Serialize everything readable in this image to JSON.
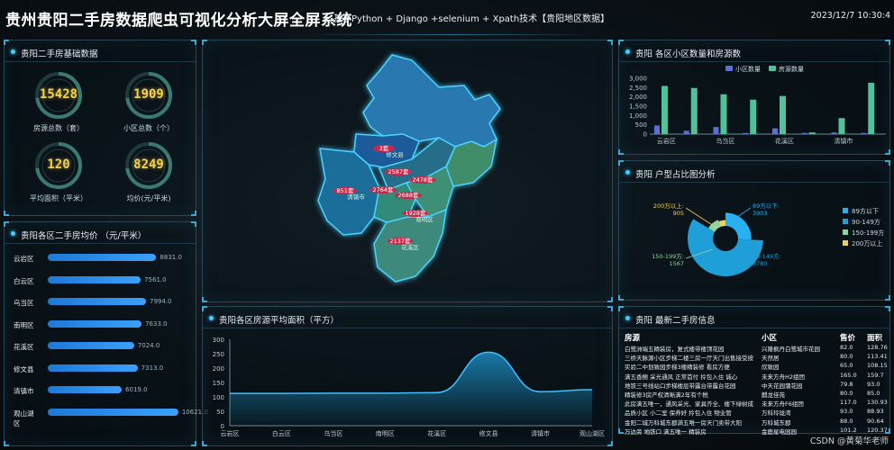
{
  "header": {
    "title": "贵州贵阳二手房数据爬虫可视化分析大屏全屏系统",
    "subtitle": "基于Python + Django +selenium + Xpath技术【贵阳地区数据】",
    "datetime": "2023/12/7 10:30:4"
  },
  "basic": {
    "title": "贵阳二手房基础数据",
    "items": [
      {
        "value": "15428",
        "label": "房源总数（套）"
      },
      {
        "value": "1909",
        "label": "小区总数（个）"
      },
      {
        "value": "120",
        "label": "平均面积（平米）"
      },
      {
        "value": "8249",
        "label": "均价(元/平米)"
      }
    ]
  },
  "price_panel": {
    "title": "贵阳各区二手房均价 （元/平米）"
  },
  "map_panel": {
    "regions": [
      {
        "count": "3套",
        "name": "修文县",
        "color": "#c8284a"
      },
      {
        "count": "2587套",
        "name": "",
        "color": "#c8284a"
      },
      {
        "count": "2478套",
        "name": "",
        "color": "#c8284a"
      },
      {
        "count": "851套",
        "name": "清镇市",
        "color": "#c8284a"
      },
      {
        "count": "2764套",
        "name": "",
        "color": "#c8284a"
      },
      {
        "count": "2688套",
        "name": "",
        "color": "#c8284a"
      },
      {
        "count": "1928套",
        "name": "南明区",
        "color": "#c8284a"
      },
      {
        "count": "2137套",
        "name": "花溪区",
        "color": "#c8284a"
      }
    ]
  },
  "area_panel": {
    "title": "贵阳各区房源平均面积（平方）"
  },
  "community_panel": {
    "title": "贵阳 各区小区数量和房源数"
  },
  "huxing_panel": {
    "title": "贵阳 户型占比图分析"
  },
  "listing_panel": {
    "title": "贵阳 最新二手房信息",
    "headers": [
      "房源",
      "小区",
      "售价",
      "面积"
    ],
    "rows": [
      [
        "白鹭洲端五精装房，复式楼带楼顶花园",
        "兴隆枫丹白鹭城市花园",
        "82.0",
        "128.76"
      ],
      [
        "三桥天脉源小区步梯二楼三房一厅天门出售接受按",
        "天然居",
        "80.0",
        "113.41"
      ],
      [
        "实验二中划致园步梯3楼精装修 看房方便",
        "欣致园",
        "65.0",
        "108.15"
      ],
      [
        "满五香榭 采光通风 正常首付 拎包入住 诚心",
        "未来方舟H2组团",
        "165.0",
        "159.7"
      ],
      [
        "地铁三号线站口步梯楼层带露台带露台花园",
        "中天花园蒲花园",
        "79.8",
        "93.0"
      ],
      [
        "精装修3房产权清晰满2年有个税",
        "麒龙佳苑",
        "80.0",
        "85.0"
      ],
      [
        "此房满五唯一，通风采光、家具齐全、楼下绿树成",
        "未来方舟F6组团",
        "117.0",
        "130.93"
      ],
      [
        "品质小区 小二室 保养好 拎包入住 物业管",
        "万科玲珑湾",
        "93.0",
        "88.93"
      ],
      [
        "金阳二城万科城东郡满五唯一房天门卖带大阳",
        "万科城东郡",
        "88.0",
        "90.64"
      ],
      [
        "万达旁 地铁口 满五唯一 精装房",
        "金鹿星电园园",
        "101.2",
        "120.37"
      ]
    ]
  },
  "watermark": "CSDN @黄菊华老师",
  "chart_data": [
    {
      "type": "bar",
      "title": "贵阳各区二手房均价 （元/平米）",
      "categories": [
        "云岩区",
        "白云区",
        "乌当区",
        "南明区",
        "花溪区",
        "修文县",
        "清镇市",
        "观山湖区"
      ],
      "values": [
        8831.0,
        7561.0,
        7994.0,
        7633.0,
        7024.0,
        7313.0,
        6019.0,
        10621.0
      ],
      "value_labels": [
        "8831.0",
        "7561.0",
        "7994.0",
        "7633.0",
        "7024.0",
        "7313.0",
        "6019.0",
        "10621.0"
      ],
      "orientation": "horizontal",
      "xlim": [
        0,
        11000
      ]
    },
    {
      "type": "area",
      "title": "贵阳各区房源平均面积（平方）",
      "categories": [
        "云岩区",
        "白云区",
        "乌当区",
        "南明区",
        "花溪区",
        "修文县",
        "清镇市",
        "观山湖区"
      ],
      "values": [
        112,
        112,
        113,
        113,
        115,
        255,
        118,
        125
      ],
      "ylim": [
        0,
        300
      ],
      "yticks": [
        "0",
        "50",
        "100",
        "150",
        "200",
        "250",
        "300"
      ],
      "grid": false
    },
    {
      "type": "bar",
      "title": "贵阳 各区小区数量和房源数",
      "categories": [
        "云岩区",
        "乌当区",
        "花溪区",
        "清镇市"
      ],
      "series": [
        {
          "name": "小区数量",
          "values": [
            460,
            180,
            380,
            60,
            310,
            60,
            90,
            60
          ],
          "color": "#5b6fd8"
        },
        {
          "name": "房源数量",
          "values": [
            2590,
            2480,
            2140,
            1850,
            2050,
            90,
            860,
            2760
          ],
          "color": "#4fc29b"
        }
      ],
      "all_categories": [
        "云岩区",
        "白云区",
        "乌当区",
        "南明区",
        "花溪区",
        "修文县",
        "清镇市",
        "观山湖区"
      ],
      "ylim": [
        0,
        3000
      ],
      "yticks": [
        "3,000",
        "2,500",
        "2,000",
        "1,500",
        "1,000",
        "500",
        "0"
      ],
      "legend": "top"
    },
    {
      "type": "pie",
      "title": "贵阳 户型占比图分析",
      "slices": [
        {
          "name": "89方以下",
          "value": 3903,
          "label": "89方以下:\n3903",
          "color": "#29b0f0"
        },
        {
          "name": "90-149方",
          "value": 8780,
          "label": "90-149方:\n8780",
          "color": "#1f9fd8"
        },
        {
          "name": "150-199方",
          "value": 1567,
          "label": "150-199方:\n1567",
          "color": "#8ad4a0"
        },
        {
          "name": "200万以上",
          "value": 905,
          "label": "200万以上:\n905",
          "color": "#f2cf5b"
        }
      ],
      "legend": "right"
    }
  ]
}
